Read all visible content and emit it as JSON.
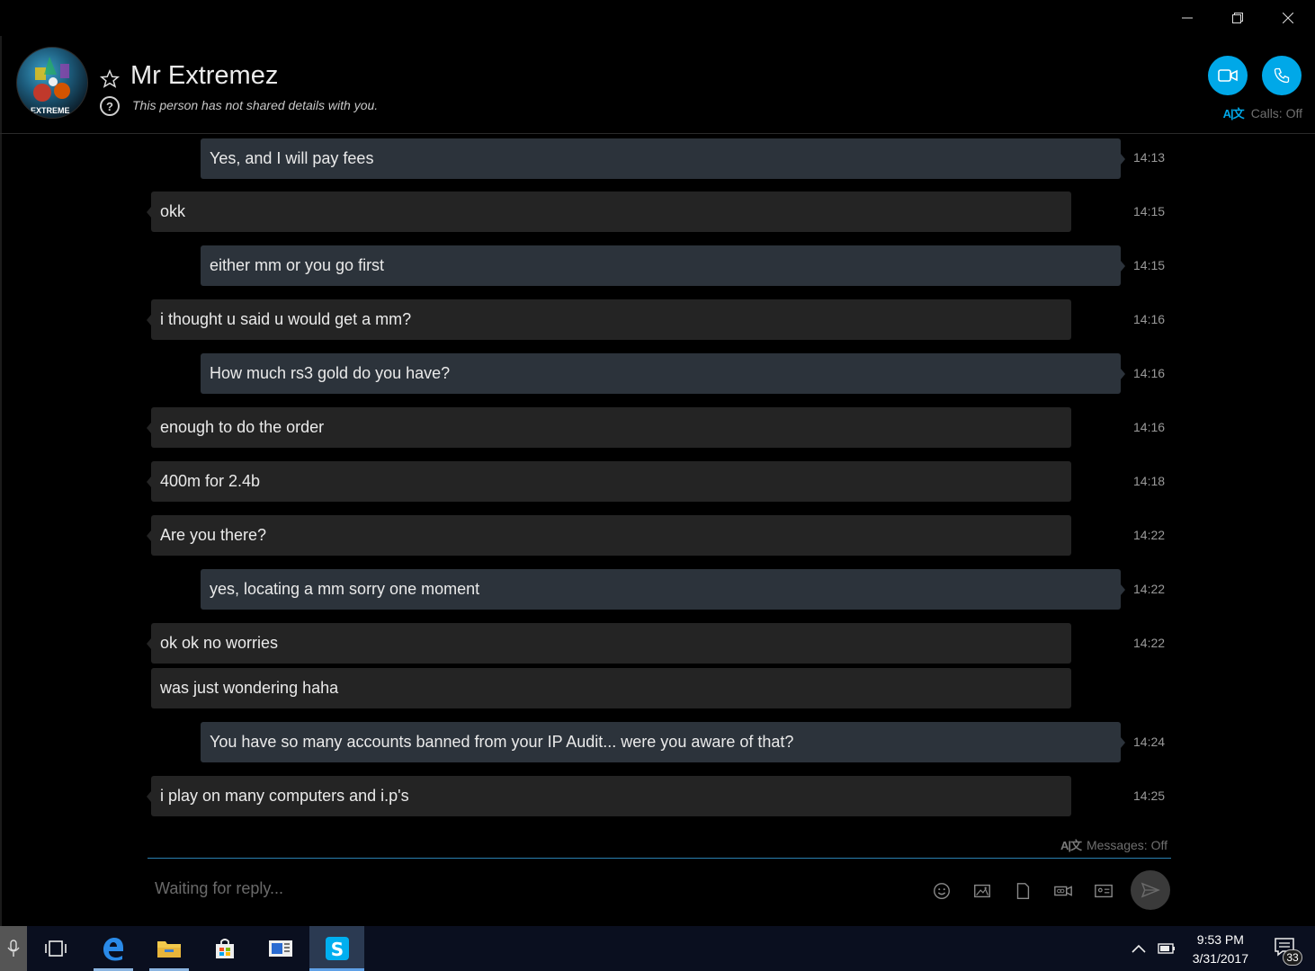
{
  "window": {
    "minimize_icon": "minimize-icon",
    "restore_icon": "restore-icon",
    "close_icon": "close-icon"
  },
  "header": {
    "contact_name": "Mr Extremez",
    "status_text": "This person has not shared details with you.",
    "avatar_text": "R EXTREME",
    "calls_status": "Calls: Off",
    "accent_color": "#00a8e8"
  },
  "messages": [
    {
      "type": "sent",
      "text": "Yes, and I will pay fees",
      "time": "14:13"
    },
    {
      "type": "recv",
      "text": "okk",
      "time": "14:15"
    },
    {
      "type": "sent",
      "text": "either mm or you go first",
      "time": "14:15"
    },
    {
      "type": "recv",
      "text": "i thought u said u would get a mm?",
      "time": "14:16"
    },
    {
      "type": "sent",
      "text": "How much rs3 gold do you have?",
      "time": "14:16"
    },
    {
      "type": "recv",
      "text": "enough to do the order",
      "time": "14:16"
    },
    {
      "type": "recv",
      "text": "400m for 2.4b",
      "time": "14:18"
    },
    {
      "type": "recv",
      "text": "Are you there?",
      "time": "14:22"
    },
    {
      "type": "sent",
      "text": "yes, locating a mm sorry one moment",
      "time": "14:22"
    },
    {
      "type": "recv",
      "text": "ok ok no worries",
      "time": "14:22"
    },
    {
      "type": "recv",
      "text": "was just wondering haha",
      "time": ""
    },
    {
      "type": "sent",
      "text": "You have so many accounts banned from your IP Audit... were you aware of that?",
      "time": "14:24"
    },
    {
      "type": "recv",
      "text": "i play on many computers and i.p's",
      "time": "14:25"
    }
  ],
  "composer": {
    "messages_status": "Messages: Off",
    "placeholder": "Waiting for reply...",
    "tools": [
      "emoji-icon",
      "photo-icon",
      "file-icon",
      "video-message-icon",
      "contact-card-icon"
    ]
  },
  "taskbar": {
    "apps": [
      "microphone-icon",
      "task-view-icon",
      "edge-icon",
      "file-explorer-icon",
      "store-icon",
      "news-app-icon",
      "skype-icon"
    ],
    "time": "9:53 PM",
    "date": "3/31/2017",
    "notification_count": "33"
  }
}
